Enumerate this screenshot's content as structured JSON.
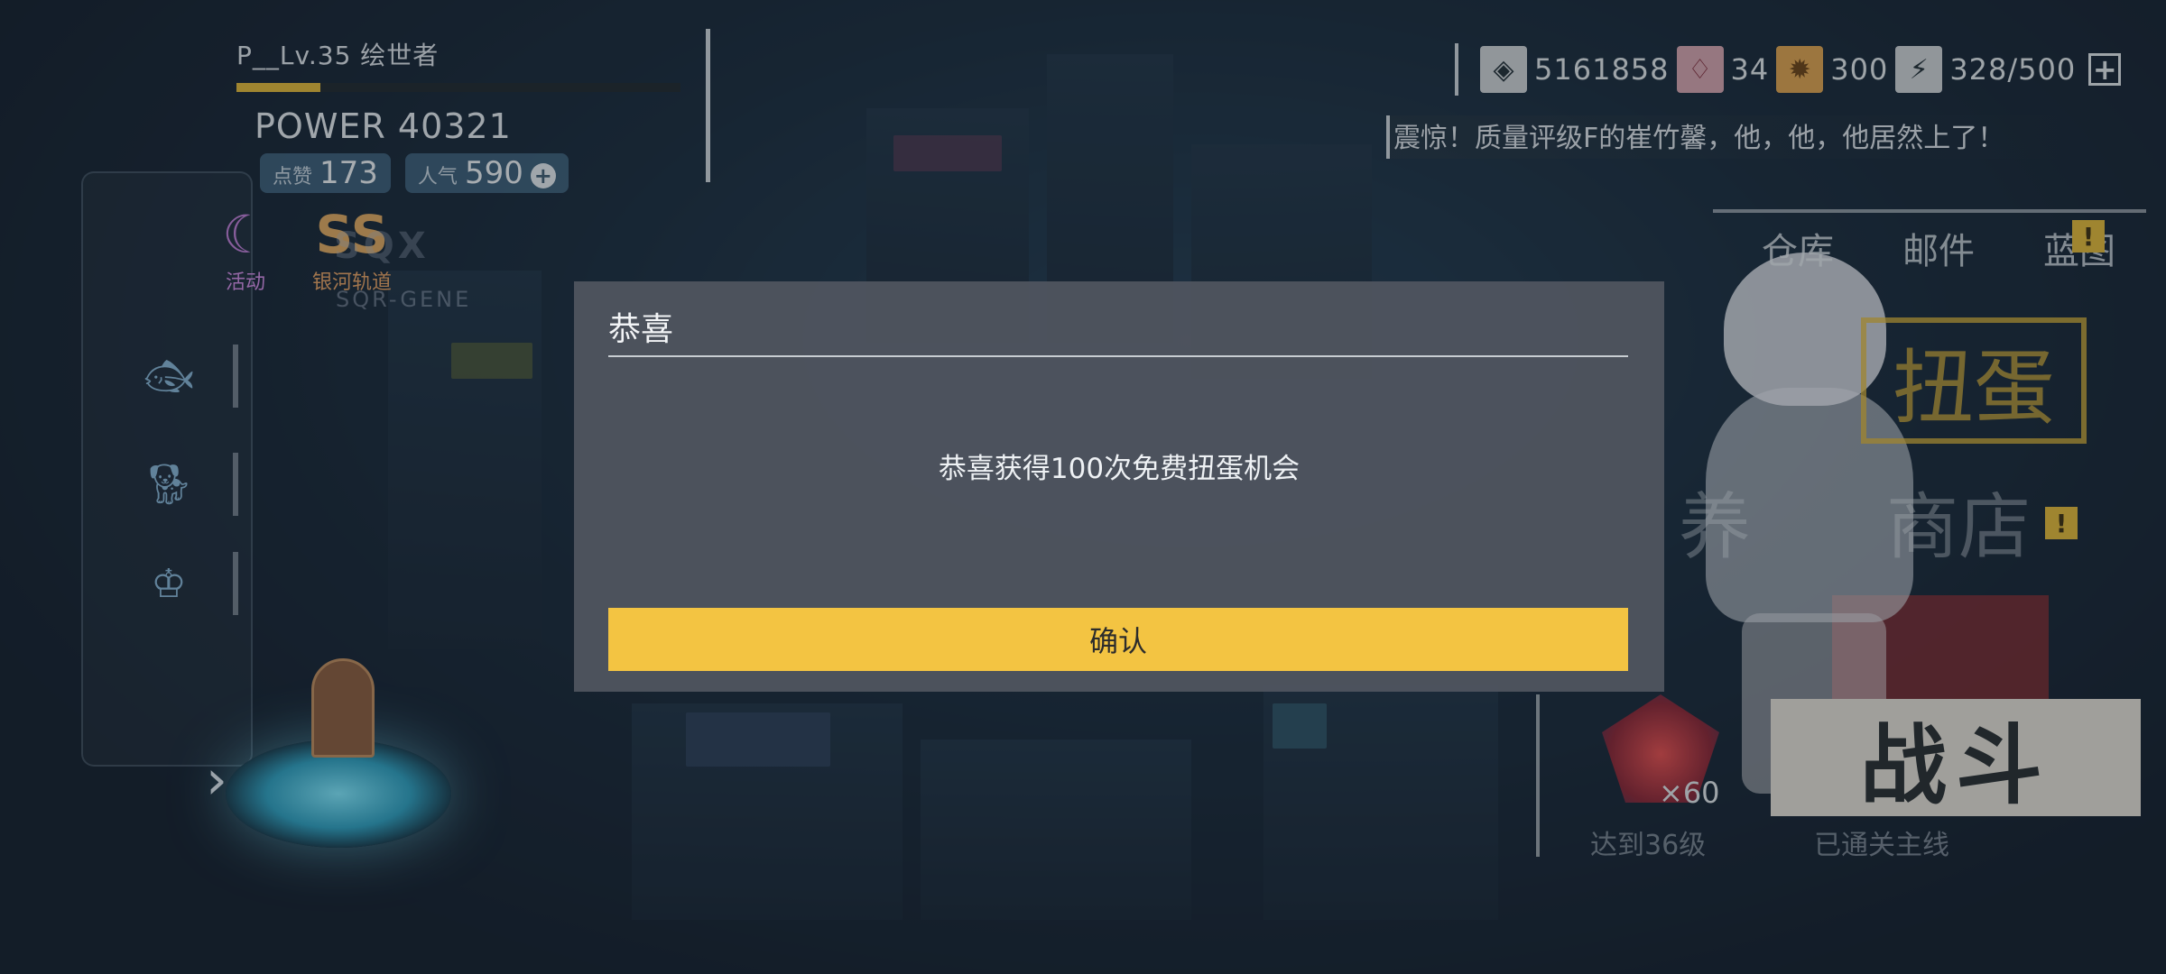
{
  "player": {
    "name": "P__Lv.35 绘世者",
    "xp_progress": 0.19,
    "power_label": "POWER",
    "power_value": "40321",
    "likes_label": "点赞",
    "likes_value": "173",
    "popularity_label": "人气",
    "popularity_value": "590",
    "popularity_add_icon": "plus-circle-icon"
  },
  "events": {
    "activity_label": "活动",
    "galaxy_label": "银河轨道",
    "galaxy_glyph": "SS",
    "logo_text": "SQX",
    "logo_sub": "SQR-GENE"
  },
  "currencies": [
    {
      "icon": "coin-icon",
      "glyph": "◈",
      "value": "5161858"
    },
    {
      "icon": "red-gem-icon",
      "glyph": "♢",
      "value": "34"
    },
    {
      "icon": "gold-gear-icon",
      "glyph": "✹",
      "value": "300"
    },
    {
      "icon": "energy-icon",
      "glyph": "⚡",
      "value": "328/500"
    }
  ],
  "news_ticker": "震惊！质量评级F的崔竹馨，他，他，他居然上了！",
  "right_nav": {
    "warehouse": "仓库",
    "mail": "邮件",
    "blueprint": "蓝图",
    "badge": "!"
  },
  "tiles": {
    "gacha": "扭蛋",
    "shop": "商店",
    "training_partial": "养",
    "badge": "!"
  },
  "battle": {
    "label": "战斗",
    "gem_count": "×60",
    "note_level": "达到36级",
    "note_main": "已通关主线"
  },
  "modal": {
    "title": "恭喜",
    "message": "恭喜获得100次免费扭蛋机会",
    "confirm_label": "确认"
  },
  "colors": {
    "accent_yellow": "#f3c442",
    "modal_bg": "#4e545e",
    "xp_fill": "#e5b833"
  }
}
